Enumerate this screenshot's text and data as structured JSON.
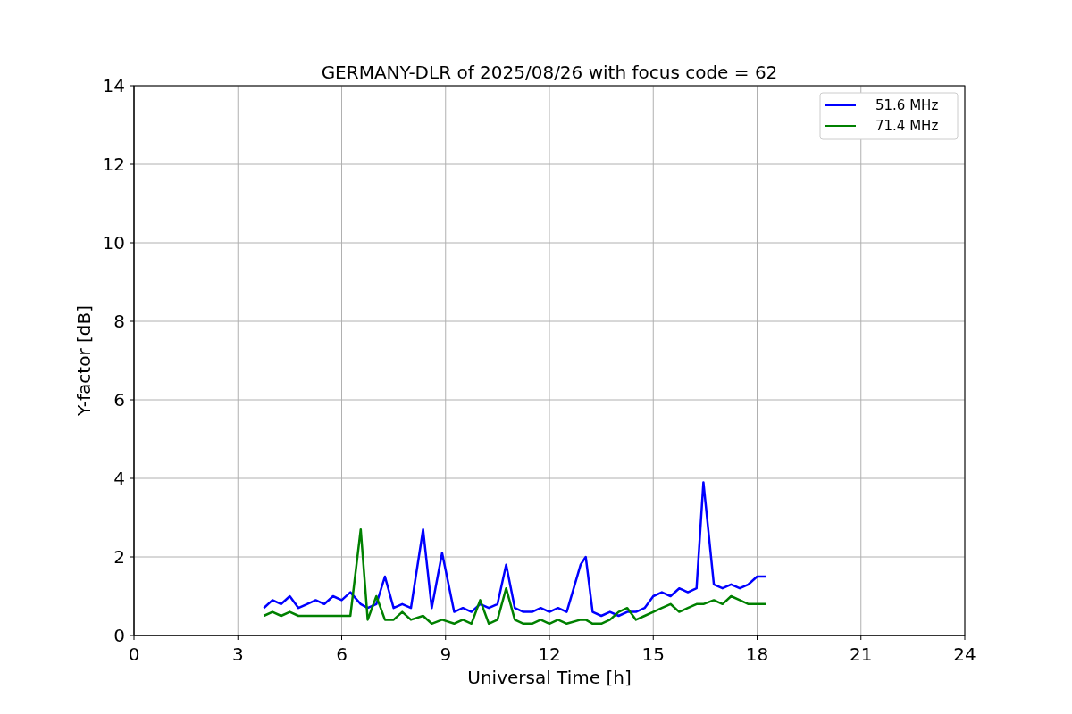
{
  "chart_data": {
    "type": "line",
    "title": "GERMANY-DLR of 2025/08/26 with focus code = 62",
    "xlabel": "Universal Time [h]",
    "ylabel": "Y-factor [dB]",
    "x": [
      3.75,
      4,
      4.25,
      4.5,
      4.75,
      5,
      5.25,
      5.5,
      5.75,
      6,
      6.25,
      6.55,
      6.75,
      7,
      7.25,
      7.5,
      7.75,
      8,
      8.35,
      8.6,
      8.9,
      9.25,
      9.5,
      9.75,
      10,
      10.25,
      10.5,
      10.75,
      11,
      11.25,
      11.5,
      11.75,
      12,
      12.25,
      12.5,
      12.9,
      13.05,
      13.25,
      13.5,
      13.75,
      14,
      14.25,
      14.5,
      14.75,
      15,
      15.25,
      15.5,
      15.75,
      16,
      16.25,
      16.45,
      16.75,
      17,
      17.25,
      17.5,
      17.75,
      18,
      18.25
    ],
    "series": [
      {
        "name": "51.6 MHz",
        "color": "#0000ff",
        "values": [
          0.7,
          0.9,
          0.8,
          1.0,
          0.7,
          0.8,
          0.9,
          0.8,
          1.0,
          0.9,
          1.1,
          0.8,
          0.7,
          0.8,
          1.5,
          0.7,
          0.8,
          0.7,
          2.7,
          0.7,
          2.1,
          0.6,
          0.7,
          0.6,
          0.8,
          0.7,
          0.8,
          1.8,
          0.7,
          0.6,
          0.6,
          0.7,
          0.6,
          0.7,
          0.6,
          1.8,
          2.0,
          0.6,
          0.5,
          0.6,
          0.5,
          0.6,
          0.6,
          0.7,
          1.0,
          1.1,
          1.0,
          1.2,
          1.1,
          1.2,
          3.9,
          1.3,
          1.2,
          1.3,
          1.2,
          1.3,
          1.5,
          1.5
        ]
      },
      {
        "name": "71.4 MHz",
        "color": "#008000",
        "values": [
          0.5,
          0.6,
          0.5,
          0.6,
          0.5,
          0.5,
          0.5,
          0.5,
          0.5,
          0.5,
          0.5,
          2.7,
          0.4,
          1.0,
          0.4,
          0.4,
          0.6,
          0.4,
          0.5,
          0.3,
          0.4,
          0.3,
          0.4,
          0.3,
          0.9,
          0.3,
          0.4,
          1.2,
          0.4,
          0.3,
          0.3,
          0.4,
          0.3,
          0.4,
          0.3,
          0.4,
          0.4,
          0.3,
          0.3,
          0.4,
          0.6,
          0.7,
          0.4,
          0.5,
          0.6,
          0.7,
          0.8,
          0.6,
          0.7,
          0.8,
          0.8,
          0.9,
          0.8,
          1.0,
          0.9,
          0.8,
          0.8,
          0.8
        ]
      }
    ],
    "grid": true,
    "legend": true,
    "xlim": [
      0,
      24
    ],
    "ylim": [
      0,
      14
    ],
    "xticks": [
      0,
      3,
      6,
      9,
      12,
      15,
      18,
      21,
      24
    ],
    "yticks": [
      0,
      2,
      4,
      6,
      8,
      10,
      12,
      14
    ]
  }
}
